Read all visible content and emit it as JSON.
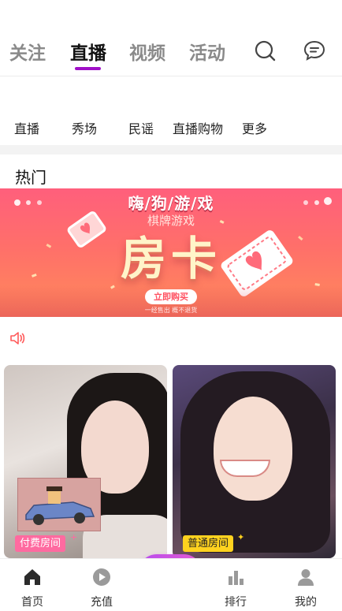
{
  "top_tabs": [
    {
      "label": "关注",
      "active": false
    },
    {
      "label": "直播",
      "active": true
    },
    {
      "label": "视频",
      "active": false
    },
    {
      "label": "活动",
      "active": false
    }
  ],
  "top_icons": {
    "search": "search-icon",
    "message": "message-icon"
  },
  "subcategories": [
    "直播",
    "秀场",
    "民谣",
    "直播购物",
    "更多"
  ],
  "section_title": "热门",
  "banner": {
    "title": "嗨/狗/游/戏",
    "subtitle": "棋牌游戏",
    "main": "房卡",
    "button": "立即购买",
    "tagline": "一经售出 概不退货"
  },
  "cards": [
    {
      "badge": "付费房间",
      "badge_color": "#ff6aa0"
    },
    {
      "badge": "普通房间",
      "badge_color": "#ffd21f"
    }
  ],
  "bottom_nav": [
    {
      "label": "首页",
      "icon": "home-icon"
    },
    {
      "label": "充值",
      "icon": "play-icon"
    },
    {
      "label": "排行",
      "icon": "rank-icon"
    },
    {
      "label": "我的",
      "icon": "user-icon"
    }
  ],
  "colors": {
    "accent": "#a010c8",
    "center_button_start": "#b64cf0",
    "center_button_end": "#e65bd0"
  }
}
